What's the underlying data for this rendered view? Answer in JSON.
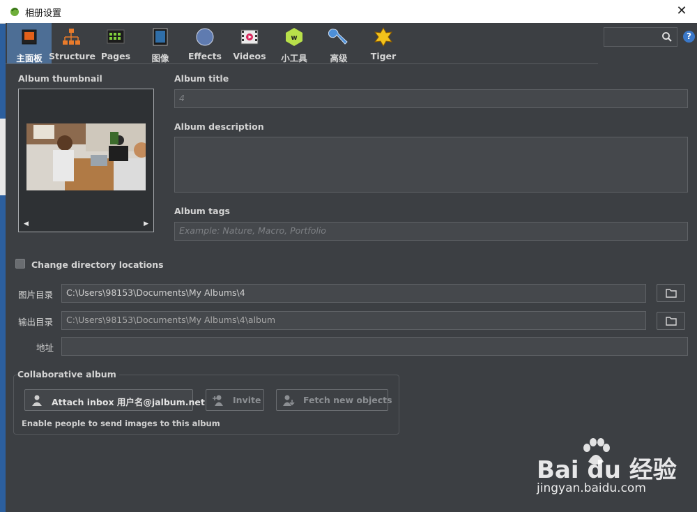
{
  "window": {
    "title": "相册设置",
    "close_symbol": "✕"
  },
  "toolbar": {
    "tabs": [
      {
        "label": "主面板",
        "icon": "main-panel-icon",
        "active": true
      },
      {
        "label": "Structure",
        "icon": "structure-icon"
      },
      {
        "label": "Pages",
        "icon": "pages-icon"
      },
      {
        "label": "图像",
        "icon": "images-icon"
      },
      {
        "label": "Effects",
        "icon": "effects-icon"
      },
      {
        "label": "Videos",
        "icon": "videos-icon"
      },
      {
        "label": "小工具",
        "icon": "widgets-icon"
      },
      {
        "label": "高级",
        "icon": "advanced-icon"
      },
      {
        "label": "Tiger",
        "icon": "tiger-icon"
      }
    ],
    "search_placeholder": "",
    "help_symbol": "?"
  },
  "album": {
    "thumbnail_label": "Album thumbnail",
    "title_label": "Album title",
    "title_value": "4",
    "description_label": "Album description",
    "description_value": "",
    "tags_label": "Album tags",
    "tags_placeholder": "Example: Nature, Macro, Portfolio",
    "thumb_prev": "◀",
    "thumb_next": "▶"
  },
  "directories": {
    "change_label": "Change directory locations",
    "change_checked": false,
    "image_dir_label": "图片目录",
    "image_dir_value": "C:\\Users\\98153\\Documents\\My Albums\\4",
    "output_dir_label": "输出目录",
    "output_dir_value": "C:\\Users\\98153\\Documents\\My Albums\\4\\album",
    "address_label": "地址",
    "address_value": ""
  },
  "collaborative": {
    "title": "Collaborative album",
    "attach_label": "Attach inbox 用户名@jalbum.net",
    "invite_label": "Invite",
    "fetch_label": "Fetch new objects",
    "note": "Enable people to send images to this album"
  },
  "watermark": {
    "brand": "Bai du 经验",
    "url": "jingyan.baidu.com"
  },
  "colors": {
    "accent": "#4d6e95",
    "background": "#3c3f43",
    "help": "#3a78c9"
  }
}
